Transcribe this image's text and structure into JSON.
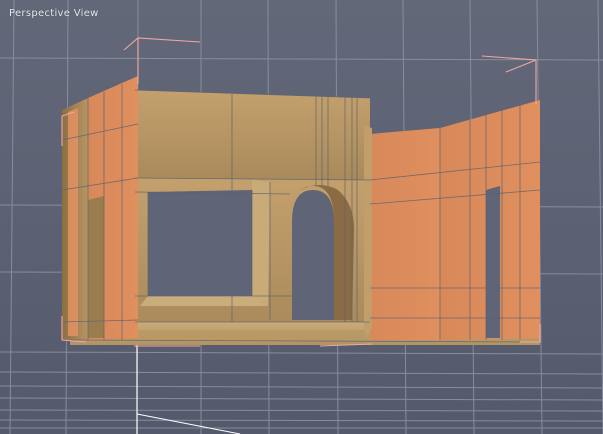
{
  "viewport": {
    "label": "Perspective View",
    "colors": {
      "background": "#5f6476",
      "grid_line": "#8c91a4",
      "selection_bracket": "#f0a7a2",
      "wall_outer": "#d98858",
      "wall_inner": "#b99a67",
      "axis_line": "#ffffff"
    }
  },
  "scene": {
    "object": "walls-with-window-and-arched-doorway",
    "selected": true
  }
}
